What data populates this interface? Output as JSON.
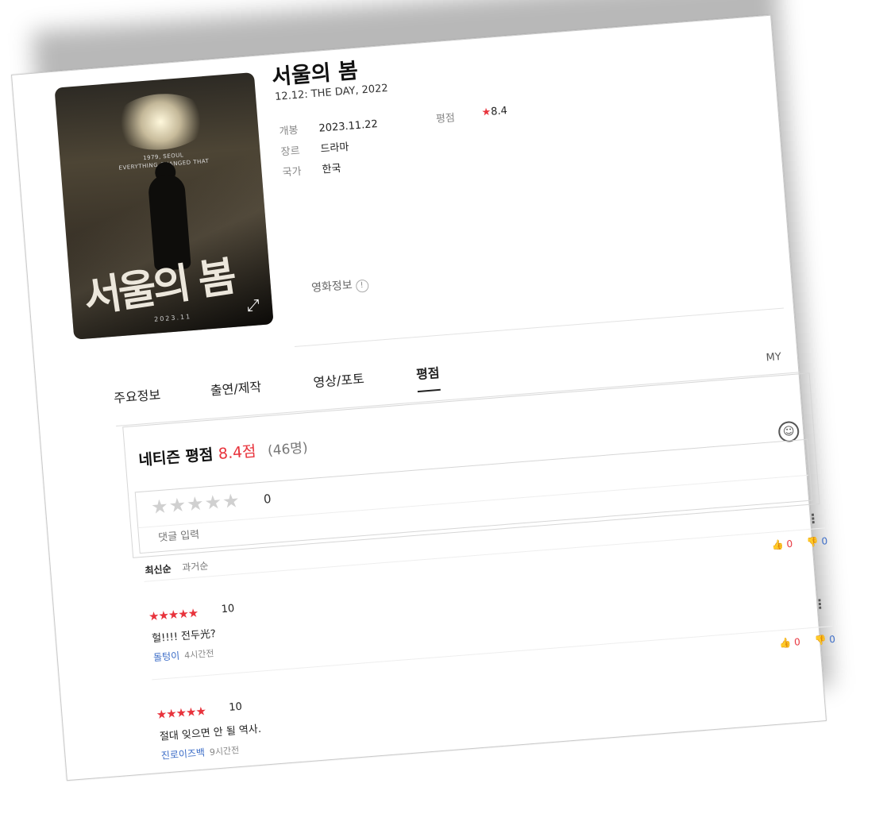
{
  "movie": {
    "title": "서울의 봄",
    "subtitle": "12.12: THE DAY, 2022",
    "release_label": "개봉",
    "release_value": "2023.11.22",
    "genre_label": "장르",
    "genre_value": "드라마",
    "country_label": "국가",
    "country_value": "한국",
    "rating_label": "평점",
    "rating_star": "★",
    "rating_value": "8.4",
    "info_link": "영화정보",
    "info_icon": "!"
  },
  "poster": {
    "tagline_1": "1979, SEOUL",
    "tagline_2": "EVERYTHING CHANGED THAT NIGHT",
    "title": "서울의 봄",
    "date": "2023.11",
    "expand_icon": "⤢"
  },
  "tabs": [
    {
      "label": "주요정보"
    },
    {
      "label": "출연/제작"
    },
    {
      "label": "영상/포토"
    },
    {
      "label": "평점"
    }
  ],
  "my_label": "MY",
  "netizen": {
    "label": "네티즌 평점",
    "score": "8.4점",
    "count": "(46명)"
  },
  "input": {
    "stars": "★★★★★",
    "star_count": "0",
    "placeholder": "댓글 입력",
    "smile_icon": "☺"
  },
  "sort": {
    "latest": "최신순",
    "oldest": "과거순"
  },
  "more_icon": "⋮",
  "reviews": [
    {
      "stars": "★★★★★",
      "score": "10",
      "text": "헐!!!! 전두光?",
      "author": "돌텅이",
      "time": "4시간전",
      "up_icon": "👍",
      "up": "0",
      "down_icon": "👎",
      "down": "0"
    },
    {
      "stars": "★★★★★",
      "score": "10",
      "text": "절대 잊으면 안 될 역사.",
      "author": "진로이즈백",
      "time": "9시간전",
      "up_icon": "👍",
      "up": "0",
      "down_icon": "👎",
      "down": "0"
    }
  ]
}
